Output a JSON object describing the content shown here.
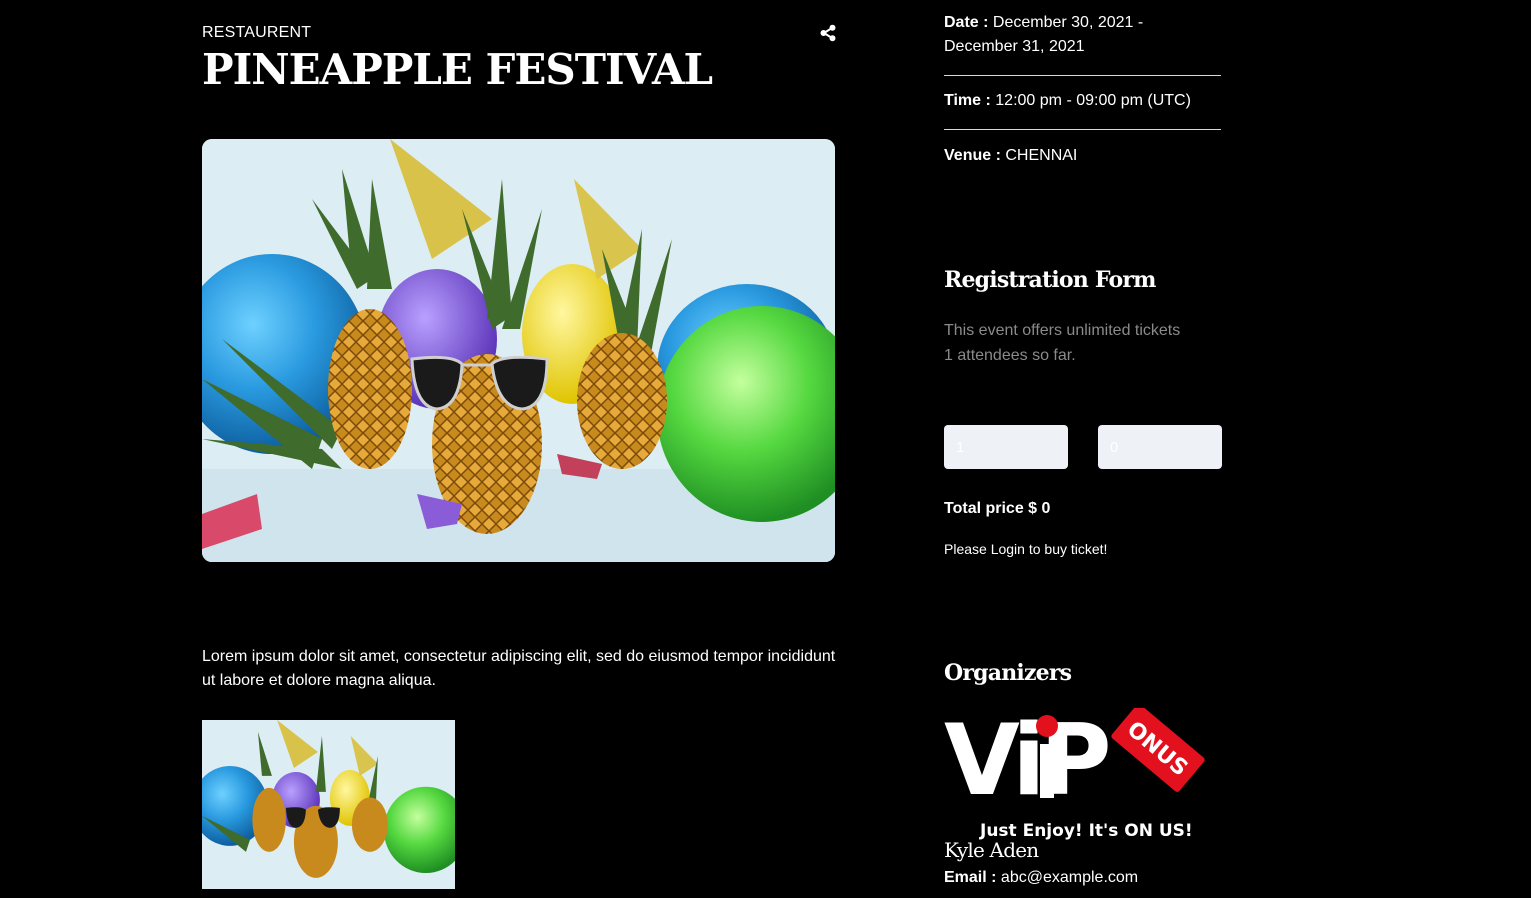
{
  "event": {
    "category": "RESTAURENT",
    "title": "PINEAPPLE FESTIVAL",
    "description": "Lorem ipsum dolor sit amet, consectetur adipiscing elit, sed do eiusmod tempor incididunt ut labore et dolore magna aliqua."
  },
  "icons": {
    "share": "share-icon"
  },
  "details": {
    "date_label": "Date :",
    "date_value": "December 30, 2021 - December 31, 2021",
    "time_label": "Time :",
    "time_value": "12:00 pm - 09:00 pm (UTC)",
    "venue_label": "Venue :",
    "venue_value": "CHENNAI"
  },
  "registration": {
    "heading": "Registration Form",
    "tickets_note": "This event offers unlimited tickets",
    "attendees_note": "1 attendees so far.",
    "quantity_value": "1",
    "price_value": "0",
    "total_label": "Total price $",
    "total_value": "0",
    "login_note": "Please Login to buy ticket!"
  },
  "organizers": {
    "heading": "Organizers",
    "logo": {
      "text": "ViP",
      "badge": "ONUS",
      "tagline": "Just Enjoy! It's ON US!"
    },
    "name": "Kyle Aden",
    "email_label": "Email :",
    "email_value": "abc@example.com"
  },
  "colors": {
    "background": "#000000",
    "text": "#ffffff",
    "muted_text": "#8a8a8a",
    "input_bg": "#eef2f6",
    "logo_red": "#e3101e"
  }
}
